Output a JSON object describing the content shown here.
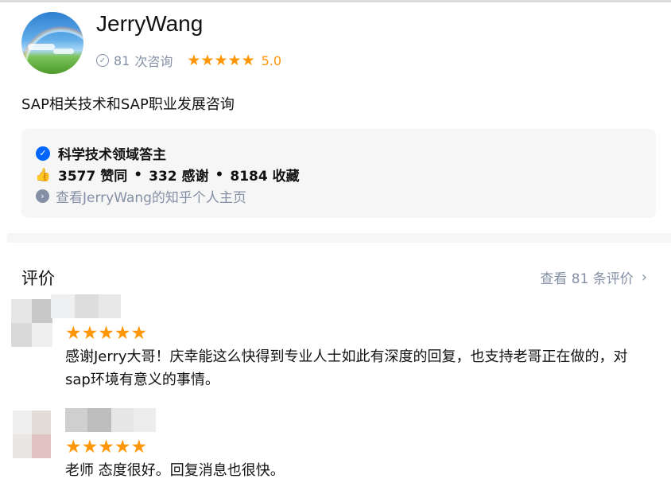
{
  "profile": {
    "name": "JerryWang",
    "consult_count": "81",
    "consult_label": "次咨询",
    "rating": "5.0",
    "description": "SAP相关技术和SAP职业发展咨询"
  },
  "card": {
    "field": "科学技术领域答主",
    "approvals": "3577 赞同",
    "thanks": "332 感谢",
    "favorites": "8184 收藏",
    "dot": "•",
    "homepage_link": "查看JerryWang的知乎个人主页"
  },
  "reviews": {
    "title": "评价",
    "view_all": "查看 81 条评价",
    "items": [
      {
        "rating": 5,
        "text": "感谢Jerry大哥！庆幸能这么快得到专业人士如此有深度的回复，也支持老哥正在做的，对sap环境有意义的事情。"
      },
      {
        "rating": 5,
        "text": "老师 态度很好。回复消息也很快。"
      }
    ]
  },
  "colors": {
    "accent": "#0066ff",
    "star": "#ff9607",
    "muted": "#8590a6"
  },
  "icons": {
    "star": "★",
    "check": "✓",
    "thumb": "👍",
    "arrow": "›",
    "chevron": "›"
  }
}
